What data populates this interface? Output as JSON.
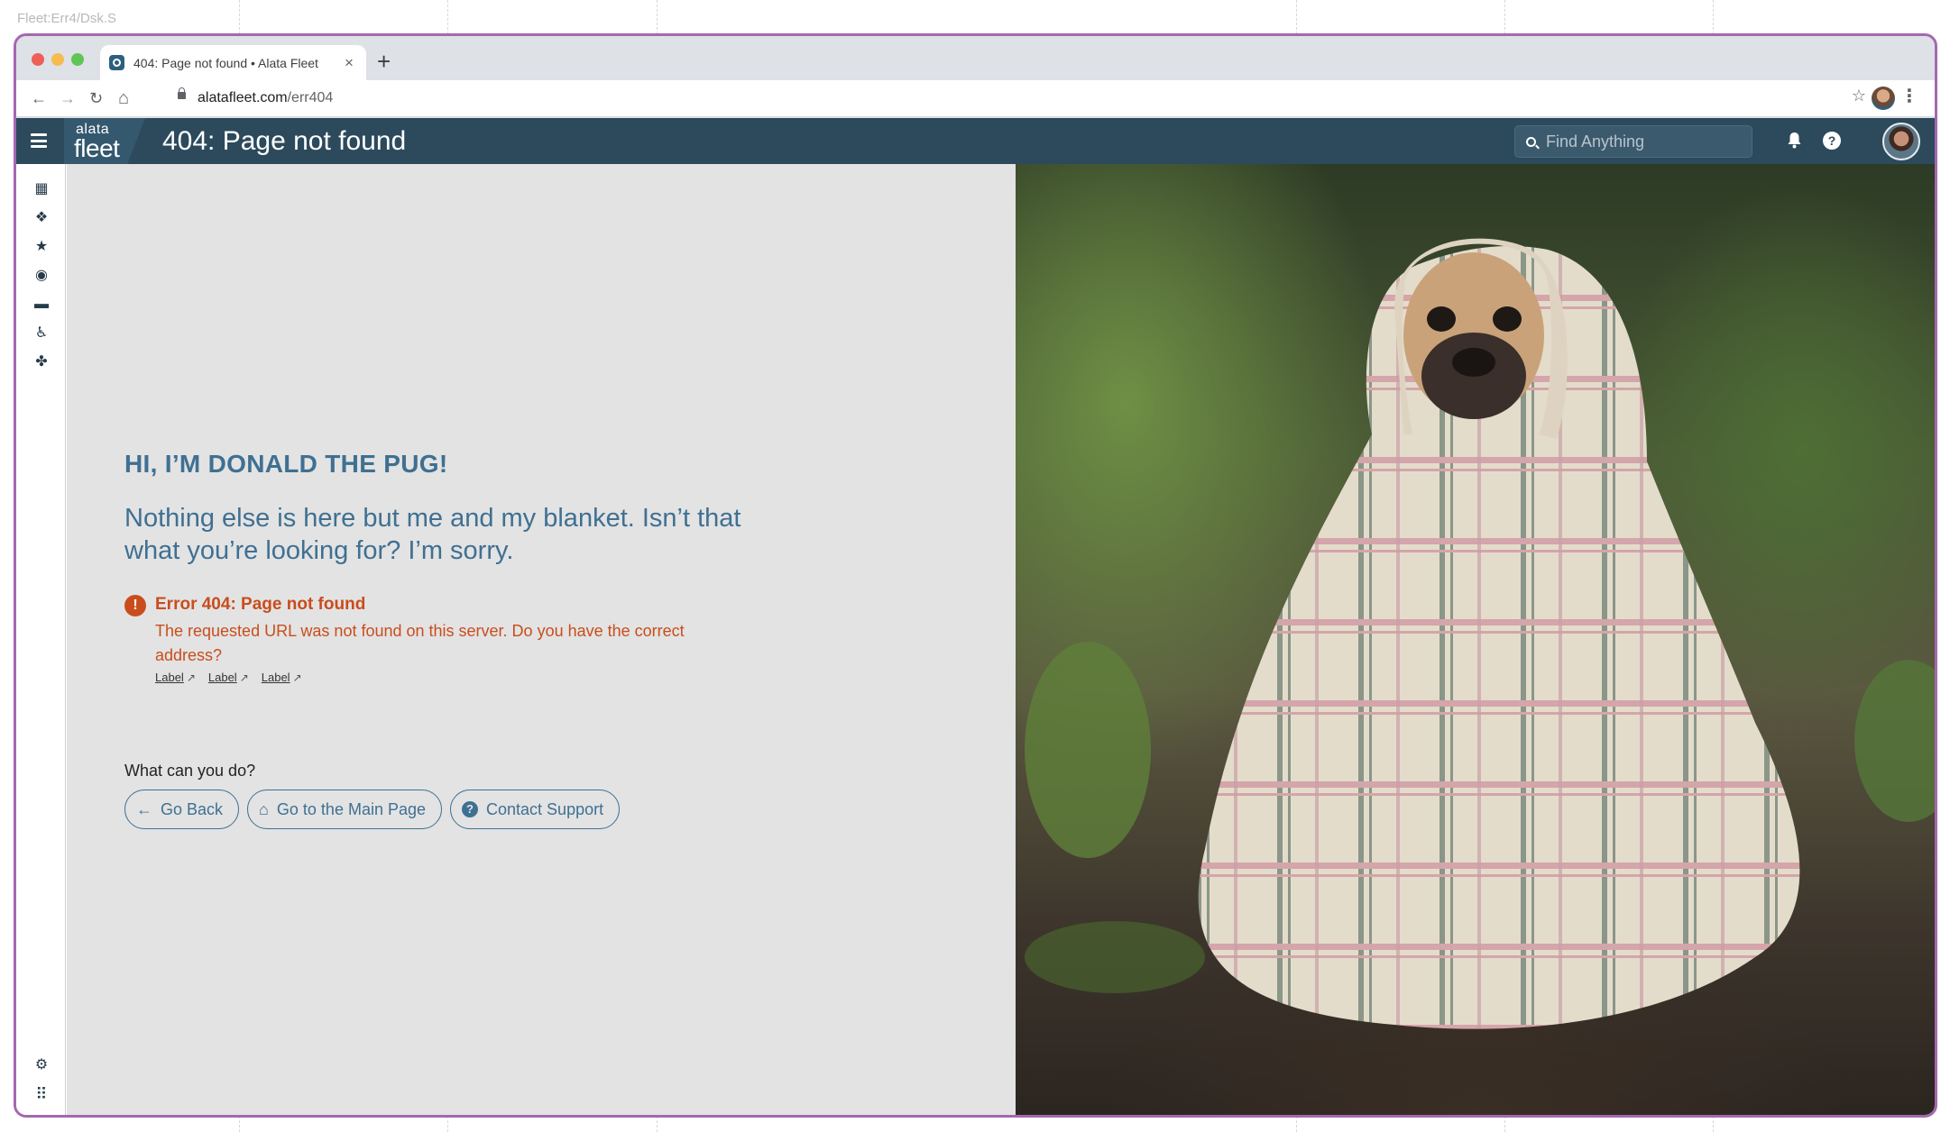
{
  "canvas_label": "Fleet:Err4/Dsk.S",
  "browser": {
    "tab_title": "404: Page not found • Alata Fleet",
    "tab_close": "×",
    "new_tab": "+",
    "url_host": "alatafleet.com",
    "url_path": "/err404",
    "back": "←",
    "forward": "→",
    "reload": "↻",
    "home": "⌂",
    "bookmark": "☆",
    "menu": "⋮"
  },
  "header": {
    "logo_top": "alata",
    "logo_bottom": "fleet",
    "title": "404: Page not found",
    "search_placeholder": "Find Anything",
    "notification_icon": "bell-icon",
    "help_icon": "help-icon",
    "help_glyph": "?"
  },
  "sidebar": {
    "items": [
      {
        "name": "dashboard-icon",
        "glyph": "▦"
      },
      {
        "name": "map-icon",
        "glyph": "❖"
      },
      {
        "name": "star-icon",
        "glyph": "★"
      },
      {
        "name": "route-icon",
        "glyph": "◉"
      },
      {
        "name": "car-icon",
        "glyph": "▬"
      },
      {
        "name": "driver-icon",
        "glyph": "♿"
      },
      {
        "name": "maple-leaf-icon",
        "glyph": "✤"
      }
    ],
    "bottom": [
      {
        "name": "settings-icon",
        "glyph": "⚙"
      },
      {
        "name": "apps-grid-icon",
        "glyph": "⠿"
      }
    ]
  },
  "content": {
    "heading": "HI, I’M DONALD THE PUG!",
    "subheading": "Nothing else is here but me and my blanket. Isn’t that what you’re looking for? I’m sorry.",
    "error_title": "Error 404: Page not found",
    "error_body": "The requested URL was not found on this server. Do you have the correct address?",
    "links": [
      "Label",
      "Label",
      "Label"
    ],
    "prompt": "What can you do?",
    "actions": [
      {
        "label": "Go Back",
        "icon": "arrow-left-icon",
        "glyph": "←"
      },
      {
        "label": "Go to the Main Page",
        "icon": "home-icon",
        "glyph": "⌂"
      },
      {
        "label": "Contact Support",
        "icon": "question-circle-icon",
        "glyph": "?"
      }
    ]
  },
  "colors": {
    "header_bg": "#2c4a5c",
    "accent": "#3f7092",
    "error": "#c94d1c",
    "window_border": "#a567b0"
  }
}
